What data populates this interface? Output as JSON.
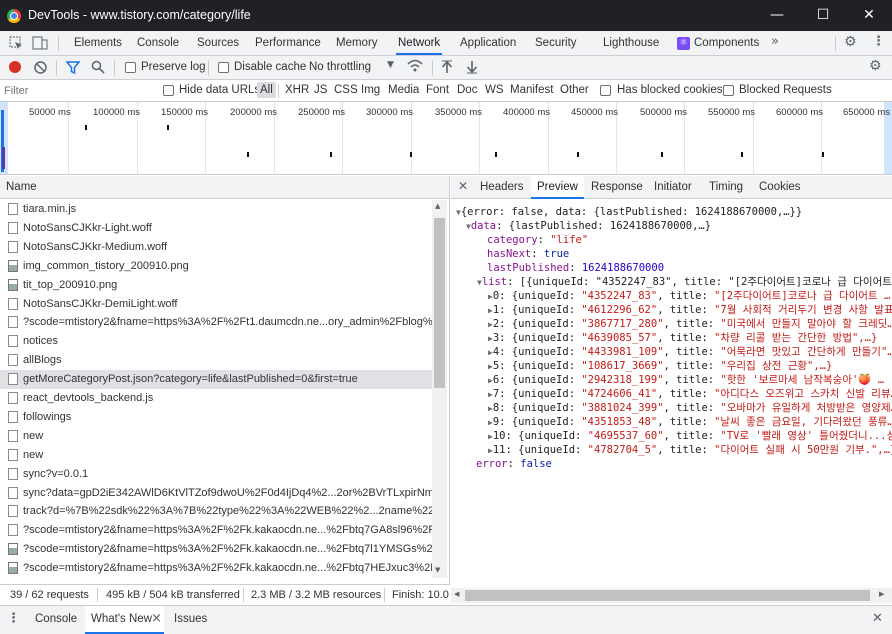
{
  "window": {
    "title": "DevTools - www.tistory.com/category/life",
    "minimize": "—",
    "maximize": "☐",
    "close": "✕"
  },
  "tabs": [
    "Elements",
    "Console",
    "Sources",
    "Performance",
    "Memory",
    "Network",
    "Application",
    "Security",
    "Lighthouse",
    "Components"
  ],
  "active_tab": "Network",
  "toolbar": {
    "preserve_log": "Preserve log",
    "disable_cache": "Disable cache",
    "throttling": "No throttling"
  },
  "filter": {
    "placeholder": "Filter",
    "hide_data_urls": "Hide data URLs",
    "types": [
      "All",
      "XHR",
      "JS",
      "CSS",
      "Img",
      "Media",
      "Font",
      "Doc",
      "WS",
      "Manifest",
      "Other"
    ],
    "has_blocked_cookies": "Has blocked cookies",
    "blocked_requests": "Blocked Requests"
  },
  "overview": {
    "ticks": [
      "50000 ms",
      "100000 ms",
      "150000 ms",
      "200000 ms",
      "250000 ms",
      "300000 ms",
      "350000 ms",
      "400000 ms",
      "450000 ms",
      "500000 ms",
      "550000 ms",
      "600000 ms",
      "650000 ms"
    ]
  },
  "requests": {
    "column": "Name",
    "rows": [
      "tiara.min.js",
      "NotoSansCJKkr-Light.woff",
      "NotoSansCJKkr-Medium.woff",
      "img_common_tistory_200910.png",
      "tit_top_200910.png",
      "NotoSansCJKkr-DemiLight.woff",
      "?scode=mtistory2&fname=https%3A%2F%2Ft1.daumcdn.ne...ory_admin%2Fblog%2Fa",
      "notices",
      "allBlogs",
      "getMoreCategoryPost.json?category=life&lastPublished=0&first=true",
      "react_devtools_backend.js",
      "followings",
      "new",
      "new",
      "sync?v=0.0.1",
      "sync?data=gpD2iE342AWlD6KtVlTZof9dwoU%2F0d4IjDq4%2...2or%2BVrTLxpirNm46af",
      "track?d=%7B%22sdk%22%3A%7B%22type%22%3A%22WEB%22%2...2name%22%3A",
      "?scode=mtistory2&fname=https%3A%2F%2Fk.kakaocdn.ne...%2Fbtq7GA8sl96%2FQ6",
      "?scode=mtistory2&fname=https%3A%2F%2Fk.kakaocdn.ne...%2Fbtq7l1YMSGs%2Fe1",
      "?scode=mtistory2&fname=https%3A%2F%2Fk.kakaocdn.ne...%2Fbtq7HEJxuc3%2FfN"
    ]
  },
  "status": {
    "requests": "39 / 62 requests",
    "transferred": "495 kB / 504 kB transferred",
    "resources": "2.3 MB / 3.2 MB resources",
    "finish": "Finish: 10.0"
  },
  "detail_tabs": [
    "Headers",
    "Preview",
    "Response",
    "Initiator",
    "Timing",
    "Cookies"
  ],
  "active_detail_tab": "Preview",
  "preview": {
    "root": "{error: false, data: {lastPublished: 1624188670000,…}}",
    "data_key": "data",
    "data_summary": "{lastPublished: 1624188670000,…}",
    "category_key": "category",
    "category": "\"life\"",
    "hasNext_key": "hasNext",
    "hasNext": "true",
    "lastPublished_key": "lastPublished",
    "lastPublished": "1624188670000",
    "list_key": "list",
    "list_summary": "[{uniqueId: \"4352247_83\", title: \"[2주다이어트]코로나 급 다이어트",
    "items": [
      {
        "idx": "0",
        "uniqueId": "\"4352247_83\"",
        "title": "\"[2주다이어트]코로나 급 다이어트 …"
      },
      {
        "idx": "1",
        "uniqueId": "\"4612296_62\"",
        "title": "\"7월 사회적 거리두기 변경 사항 발표…"
      },
      {
        "idx": "2",
        "uniqueId": "\"3867717_280\"",
        "title": "\"미국에서 만들지 말아야 할 크레딧…"
      },
      {
        "idx": "3",
        "uniqueId": "\"4639085_57\"",
        "title": "\"차량 리콜 받는 간단한 방법\",…}"
      },
      {
        "idx": "4",
        "uniqueId": "\"4433981_109\"",
        "title": "\"어묵라면 맛있고 간단하게 만들기\"…"
      },
      {
        "idx": "5",
        "uniqueId": "\"108617_3669\"",
        "title": "\"우리집 상전 근황\",…}"
      },
      {
        "idx": "6",
        "uniqueId": "\"2942318_199\"",
        "title": "\"핫한 '보르마세 남작복숭아'🍑 …"
      },
      {
        "idx": "7",
        "uniqueId": "\"4724606_41\"",
        "title": "\"아디다스 오즈위고 스카치 신발 리뷰…"
      },
      {
        "idx": "8",
        "uniqueId": "\"3881024_399\"",
        "title": "\"오바마가 유일하게 처방받은 영양제…"
      },
      {
        "idx": "9",
        "uniqueId": "\"4351853_48\"",
        "title": "\"날씨 좋은 금요일, 기다려왔던 풍류…"
      },
      {
        "idx": "10",
        "uniqueId": "\"4695537_60\"",
        "title": "\"TV로 '빨래 영상' 틀어줬더니...심"
      },
      {
        "idx": "11",
        "uniqueId": "\"4782704_5\"",
        "title": "\"다이어트 실패 시 50만원 기부.\",…}"
      }
    ],
    "error_key": "error",
    "error": "false"
  },
  "drawer": {
    "tabs": [
      "Console",
      "What's New",
      "Issues"
    ],
    "close": "×"
  },
  "colors": {
    "accent": "#1a73e8",
    "record": "#d93025",
    "titlebar": "#202124",
    "json_key": "#881391",
    "json_string": "#c41a16",
    "json_number": "#1c00cf"
  }
}
